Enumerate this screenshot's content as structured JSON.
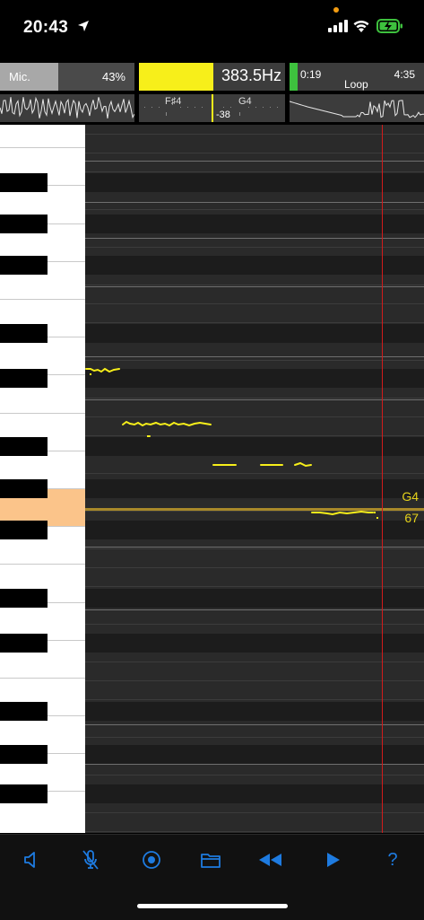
{
  "status_bar": {
    "time": "20:43",
    "icons": [
      "location-arrow-icon",
      "cellular-signal-icon",
      "wifi-icon",
      "battery-charging-icon"
    ]
  },
  "input": {
    "label": "Mic.",
    "level_percent": "43%",
    "level_fraction": 0.43
  },
  "pitch": {
    "frequency": "383.5Hz",
    "lower_note": "F♯4",
    "upper_note": "G4",
    "cents": "-38"
  },
  "playback": {
    "position": "0:19",
    "duration": "4:35",
    "mode": "Loop",
    "progress_fraction": 0.069
  },
  "roll": {
    "current_note": "G4",
    "current_midi": "67"
  },
  "toolbar": {
    "buttons": [
      "speaker-icon",
      "mic-muted-icon",
      "record-icon",
      "folder-icon",
      "rewind-icon",
      "play-icon",
      "help-icon"
    ],
    "help_label": "?"
  },
  "colors": {
    "accent_blue": "#1e7be0",
    "pitch_yellow": "#f7ef1a",
    "highlight_key": "#fbc48a",
    "playhead_red": "#d21b1b",
    "progress_green": "#3ec13e"
  }
}
